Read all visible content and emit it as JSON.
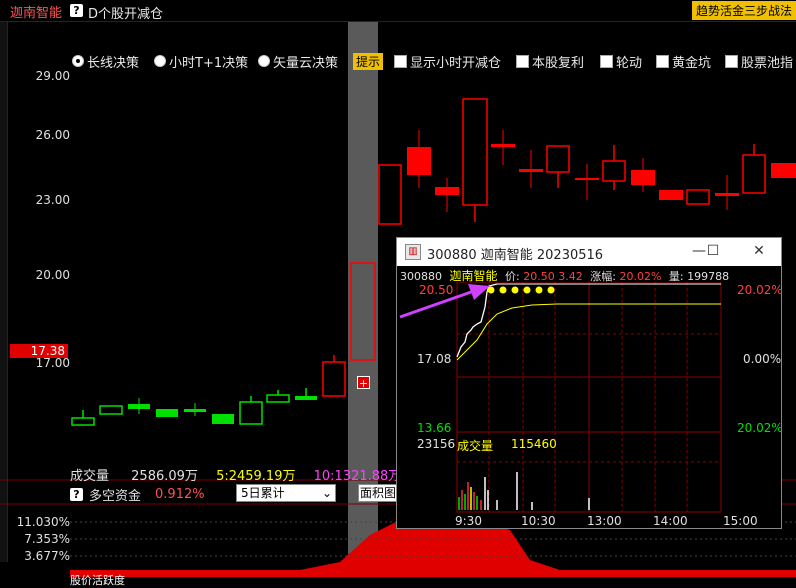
{
  "header": {
    "stock_name": "迦南智能",
    "help_icon": "?",
    "title": "D个股开减仓",
    "trend_tag": "趋势活金三步战法"
  },
  "options": [
    {
      "label": "长线决策",
      "type": "radio",
      "selected": true
    },
    {
      "label": "小时T+1决策",
      "type": "radio",
      "selected": false
    },
    {
      "label": "矢量云决策",
      "type": "radio",
      "selected": false
    }
  ],
  "tip_label": "提示",
  "checkboxes": [
    "显示小时开减仓",
    "本股复利",
    "轮动",
    "黄金坑",
    "股票池指"
  ],
  "price_axis": [
    "29.00",
    "26.00",
    "23.00",
    "20.00",
    "17.00"
  ],
  "current_price": "17.38",
  "volume_row": {
    "label": "成交量",
    "value": "2586.09万",
    "ma5": "5:2459.19万",
    "ma10": "10:1321.88万"
  },
  "capital_row": {
    "label": "多空资金",
    "value": "0.912%",
    "dropdown": "5日累计",
    "area_button": "面积图"
  },
  "capital_axis": [
    "11.030%",
    "7.353%",
    "3.677%"
  ],
  "bottom_text": "股价活跃度",
  "popup": {
    "title": "300880 迦南智能 20230516",
    "code": "300880",
    "name": "迦南智能",
    "price_label": "价:",
    "price": "20.50",
    "change": "3.42",
    "pct_label": "涨幅:",
    "pct": "20.02%",
    "vol_label": "量:",
    "vol": "199788",
    "price_high": "20.50",
    "price_mid": "17.08",
    "price_low": "13.66",
    "pct_high": "20.02%",
    "pct_mid": "0.00%",
    "pct_low": "20.02%",
    "vol_max": "23156",
    "vol_title": "成交量",
    "vol_value": "115460",
    "time_labels": [
      "9:30",
      "10:30",
      "13:00",
      "14:00",
      "15:00"
    ]
  },
  "colors": {
    "up": "#ff0000",
    "down": "#00e000",
    "accent": "#f0c000",
    "avg_line": "#ffff00",
    "arrow": "#d040ff"
  }
}
